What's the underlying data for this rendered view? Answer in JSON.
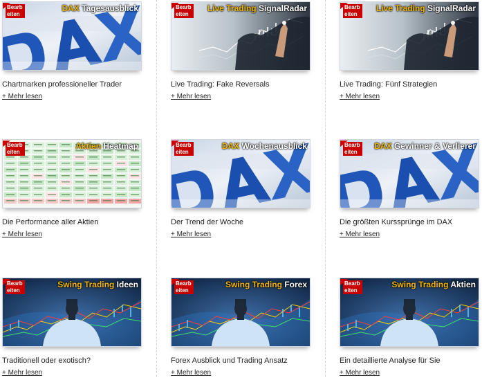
{
  "ribbon_label": "Bearb eiten",
  "more_label": "+ Mehr lesen",
  "colors": {
    "accent": "#f2b705",
    "ribbon": "#c80000",
    "separator": "#d6d6d6"
  },
  "cards": [
    {
      "overlay_a": "DAX",
      "overlay_b": "Tagesausblick",
      "image": "dax-logo",
      "caption": "Chartmarken professioneller Trader"
    },
    {
      "overlay_a": "Live Trading",
      "overlay_b": "SignalRadar",
      "image": "trader-hand-chart",
      "caption": "Live Trading: Fake Reversals"
    },
    {
      "overlay_a": "Live Trading",
      "overlay_b": "SignalRadar",
      "image": "trader-hand-chart",
      "caption": "Live Trading: Fünf Strategien"
    },
    {
      "overlay_a": "Aktien",
      "overlay_b": "Heatmap",
      "image": "heatmap-table",
      "caption": "Die Performance aller Aktien"
    },
    {
      "overlay_a": "DAX",
      "overlay_b": "Wochenausblick",
      "image": "dax-logo",
      "caption": "Der Trend der Woche"
    },
    {
      "overlay_a": "DAX",
      "overlay_b": "Gewinner & Verlierer",
      "image": "dax-logo",
      "caption": "Die größten Kurssprünge im DAX"
    },
    {
      "overlay_a": "Swing Trading",
      "overlay_b": "Ideen",
      "image": "swing-man-charts",
      "caption": "Traditionell oder exotisch?"
    },
    {
      "overlay_a": "Swing Trading",
      "overlay_b": "Forex",
      "image": "swing-man-charts",
      "caption": "Forex Ausblick und Trading Ansatz"
    },
    {
      "overlay_a": "Swing Trading",
      "overlay_b": "Aktien",
      "image": "swing-man-charts",
      "caption": "Ein detaillierte Analyse für Sie"
    }
  ]
}
